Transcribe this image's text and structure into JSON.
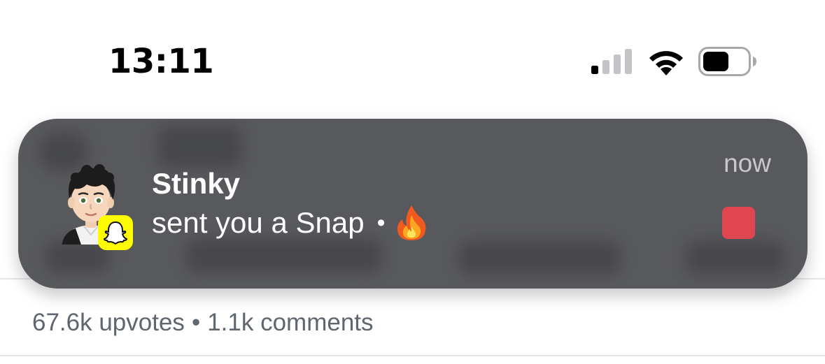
{
  "status_bar": {
    "time": "13:11",
    "signal_icon": "cellular-signal-icon",
    "wifi_icon": "wifi-icon",
    "battery_icon": "battery-icon"
  },
  "notification": {
    "app": "Snapchat",
    "app_icon": "snapchat-ghost-icon",
    "sender": "Stinky",
    "message": "sent you a Snap",
    "separator": "•",
    "emoji": "🔥",
    "timestamp": "now",
    "snap_indicator_color": "#e04650",
    "badge_color": "#fffc00"
  },
  "post": {
    "upvotes": "67.6k upvotes",
    "separator": "•",
    "comments": "1.1k comments"
  }
}
